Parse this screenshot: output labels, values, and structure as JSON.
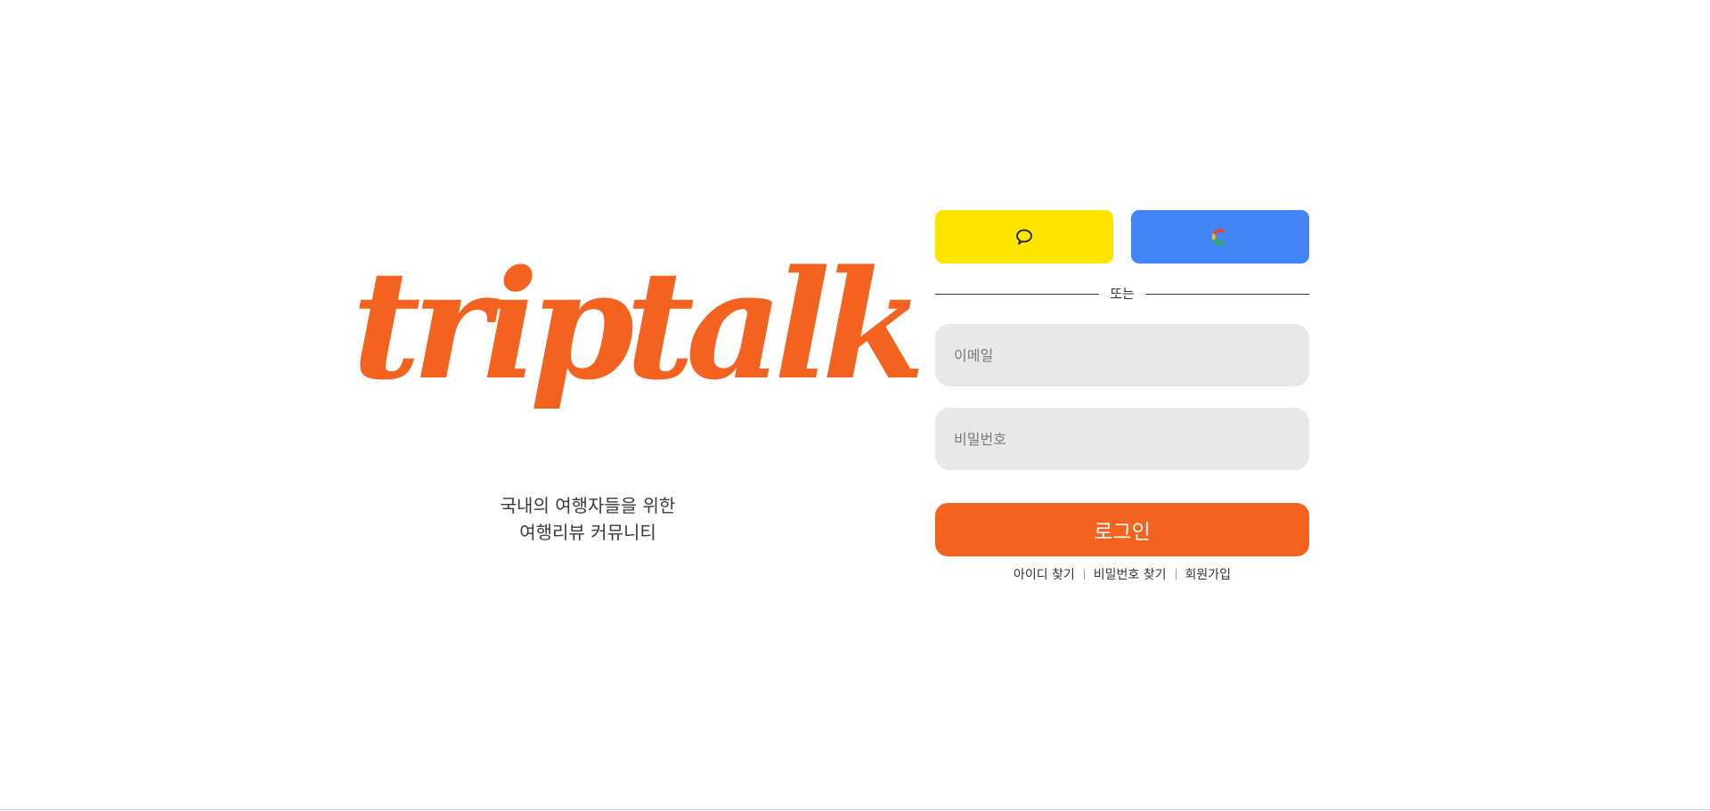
{
  "brand": {
    "logo_text": "triptalk",
    "tagline_line1": "국내의 여행자들을 위한",
    "tagline_line2": "여행리뷰 커뮤니티"
  },
  "social": {
    "kakao_icon": "speech-bubble-icon",
    "google_icon": "google-g-icon",
    "kakao_color": "#FEE500",
    "google_color": "#4285F4"
  },
  "divider": {
    "label": "또는"
  },
  "form": {
    "email_placeholder": "이메일",
    "email_value": "",
    "password_placeholder": "비밀번호",
    "password_value": "",
    "login_label": "로그인"
  },
  "links": {
    "find_id": "아이디 찾기",
    "find_password": "비밀번호 찾기",
    "signup": "회원가입"
  },
  "colors": {
    "accent": "#F4621F",
    "input_bg": "#E8E8E8"
  }
}
